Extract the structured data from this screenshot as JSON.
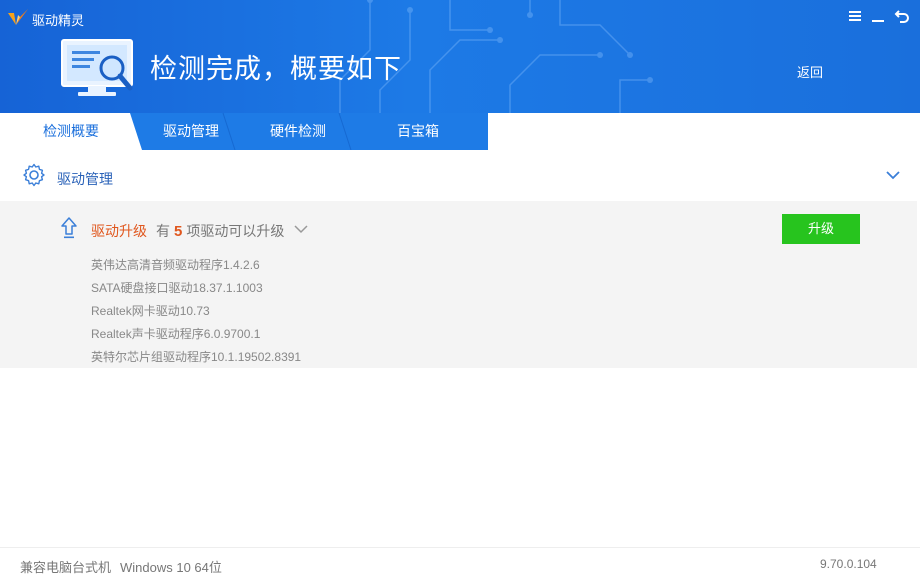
{
  "app": {
    "title": "驱动精灵"
  },
  "header": {
    "headline": "检测完成，概要如下",
    "back_label": "返回"
  },
  "window_controls": {
    "menu": "≡",
    "minimize": "—",
    "close": "↺"
  },
  "tabs": [
    {
      "label": "检测概要",
      "active": true
    },
    {
      "label": "驱动管理",
      "active": false
    },
    {
      "label": "硬件检测",
      "active": false
    },
    {
      "label": "百宝箱",
      "active": false
    }
  ],
  "section": {
    "title": "驱动管理"
  },
  "upgrade": {
    "title": "驱动升级",
    "prefix": "有",
    "count": "5",
    "suffix": "项驱动可以升级",
    "button_label": "升级",
    "drivers": [
      "英伟达高清音频驱动程序1.4.2.6",
      "SATA硬盘接口驱动18.37.1.1003",
      "Realtek网卡驱动10.73",
      "Realtek声卡驱动程序6.0.9700.1",
      "英特尔芯片组驱动程序10.1.19502.8391"
    ]
  },
  "footer": {
    "machine": "兼容电脑台式机",
    "os": "Windows 10 64位",
    "version": "9.70.0.104"
  },
  "colors": {
    "header_blue": "#1d7ae6",
    "accent_orange": "#e0571e",
    "upgrade_green": "#27c41e",
    "link_blue": "#2a62b8"
  }
}
